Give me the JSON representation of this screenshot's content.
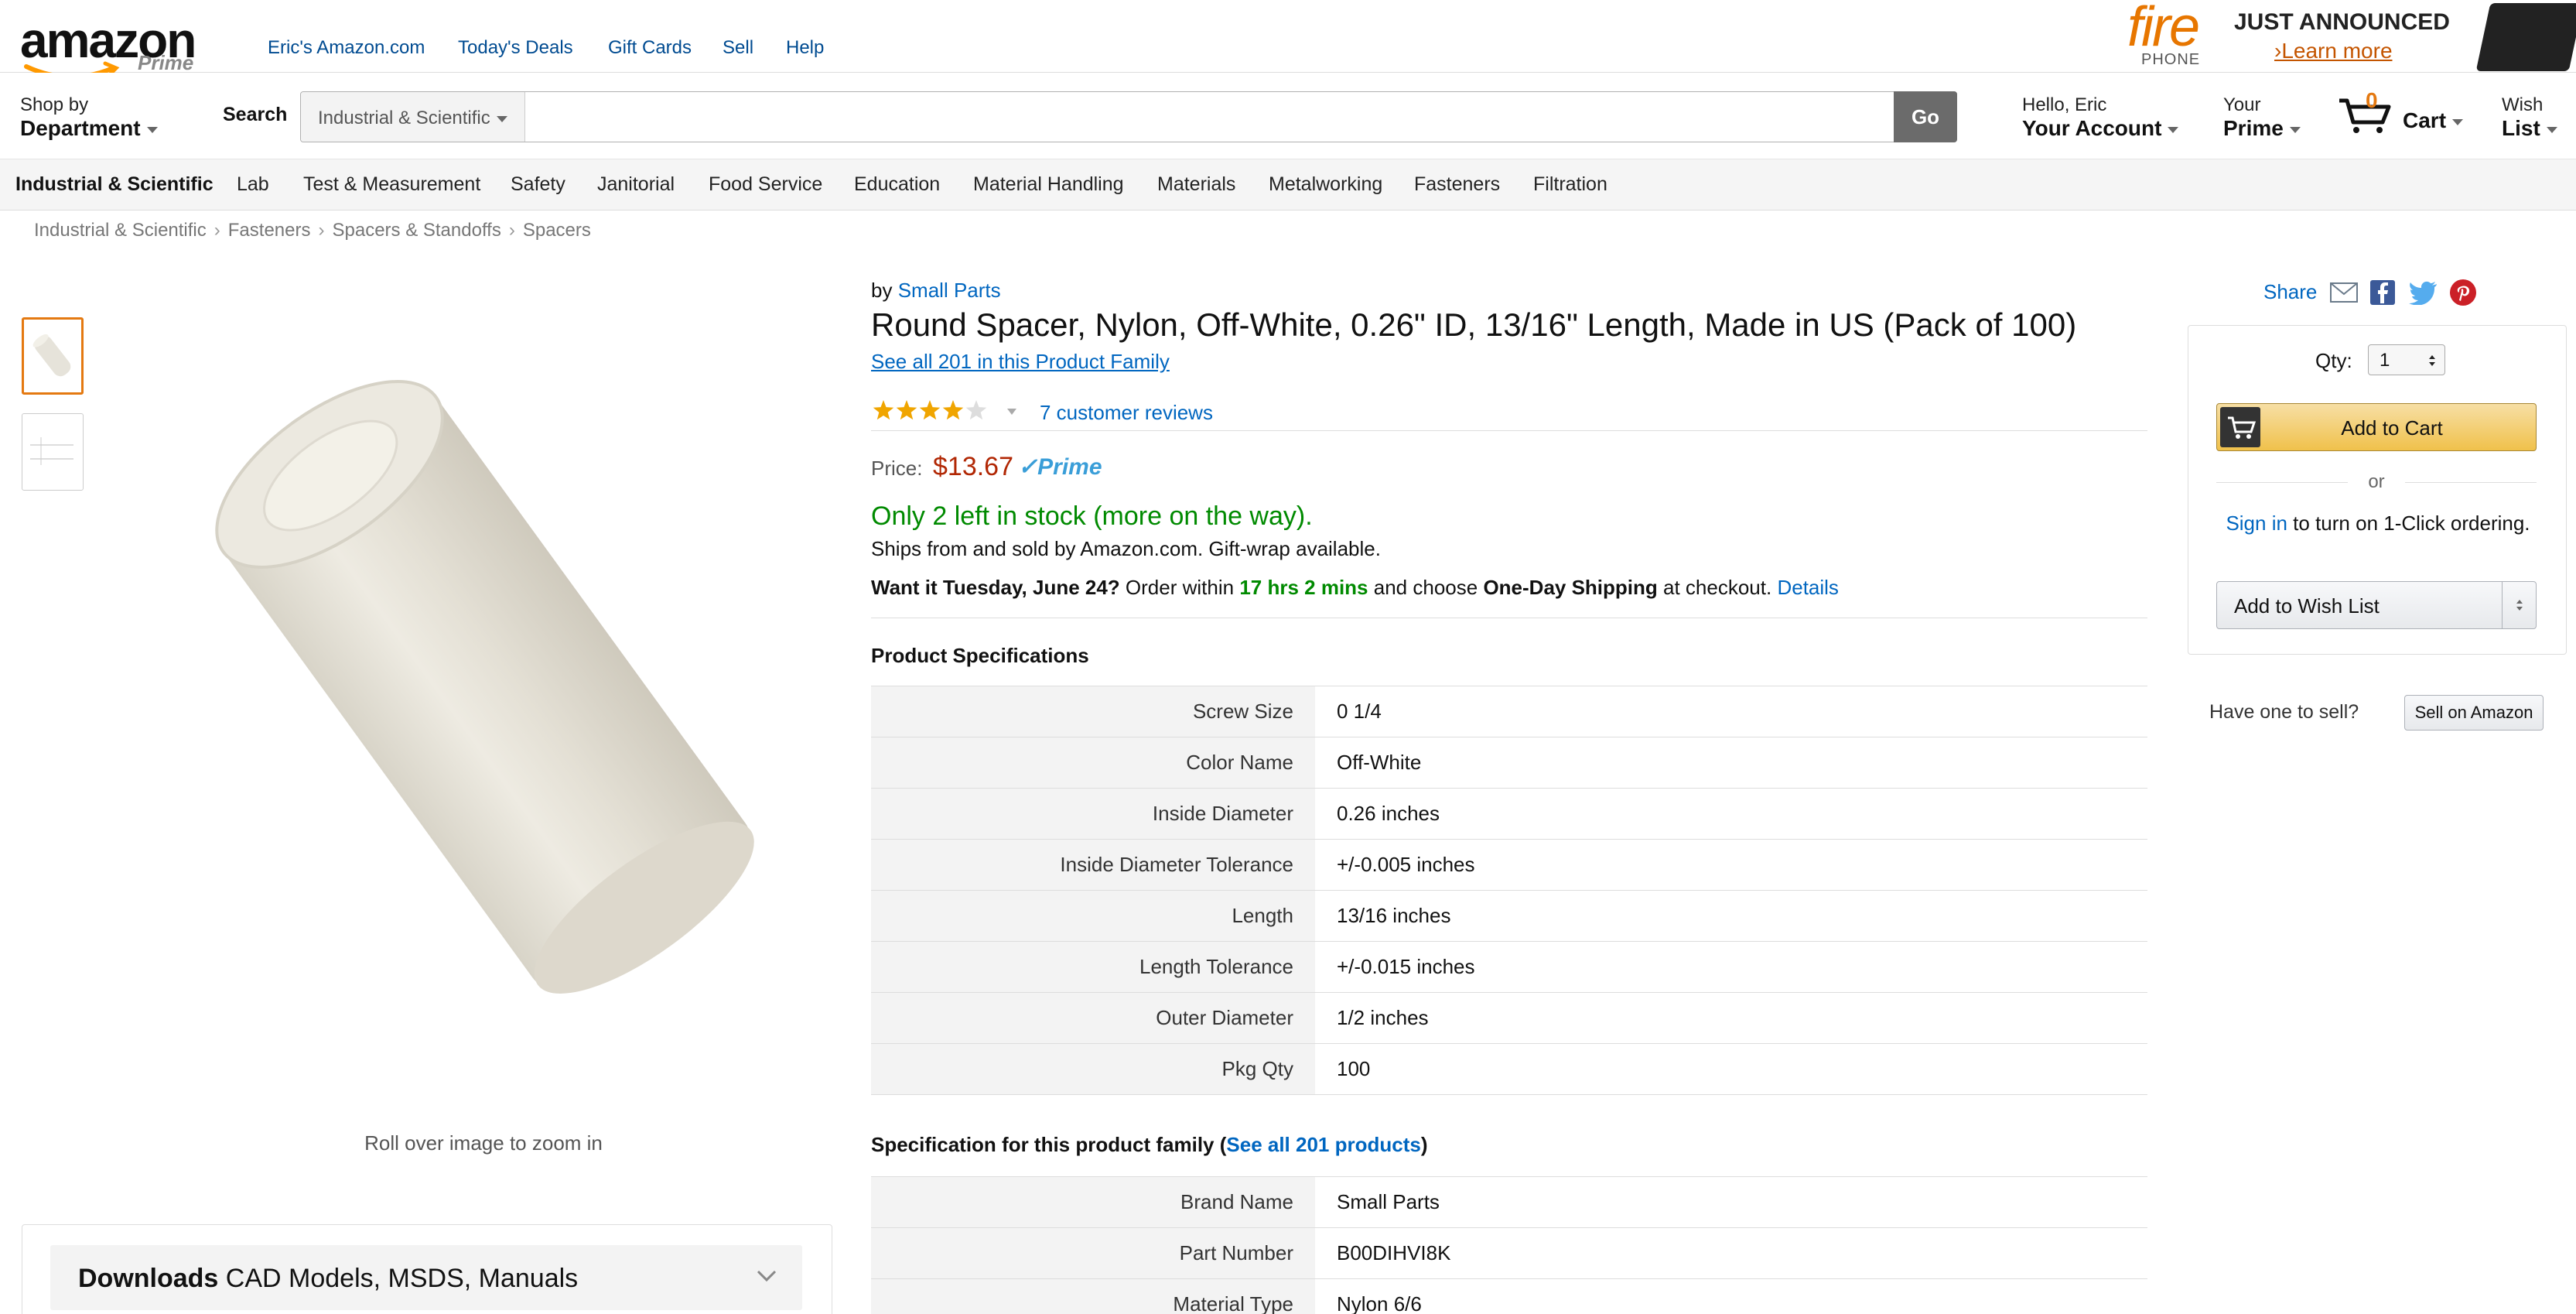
{
  "header": {
    "logo_text": "amazon",
    "logo_sub": "Prime",
    "links": [
      "Eric's Amazon.com",
      "Today's Deals",
      "Gift Cards",
      "Sell",
      "Help"
    ],
    "ad": {
      "brand": "fire",
      "sub": "PHONE",
      "headline": "JUST ANNOUNCED",
      "cta": "›Learn more"
    }
  },
  "nav": {
    "shop_by": "Shop by",
    "department": "Department",
    "search_label": "Search",
    "search_category": "Industrial & Scientific",
    "search_placeholder": "",
    "go": "Go",
    "account_small": "Hello, Eric",
    "account_big": "Your Account",
    "prime_small": "Your",
    "prime_big": "Prime",
    "cart_count": "0",
    "cart_label": "Cart",
    "wish_small": "Wish",
    "wish_big": "List"
  },
  "categories": [
    "Industrial & Scientific",
    "Lab",
    "Test & Measurement",
    "Safety",
    "Janitorial",
    "Food Service",
    "Education",
    "Material Handling",
    "Materials",
    "Metalworking",
    "Fasteners",
    "Filtration"
  ],
  "breadcrumbs": [
    "Industrial & Scientific",
    "Fasteners",
    "Spacers & Standoffs",
    "Spacers"
  ],
  "product": {
    "by": "by",
    "brand": "Small Parts",
    "title": "Round Spacer, Nylon, Off-White, 0.26\" ID, 13/16\" Length, Made in US (Pack of 100)",
    "family_link": "See all 201 in this Product Family",
    "rating": 4,
    "reviews": "7 customer reviews",
    "price_label": "Price:",
    "price": "$13.67",
    "prime": "✓Prime",
    "stock": "Only 2 left in stock (more on the way).",
    "ships": "Ships from and sold by Amazon.com. Gift-wrap available.",
    "want_a": "Want it Tuesday, June 24?",
    "want_b": "Order within",
    "want_time": "17 hrs 2 mins",
    "want_c": "and choose",
    "want_d": "One-Day Shipping",
    "want_e": "at checkout.",
    "details": "Details",
    "zoom_hint": "Roll over image to zoom in"
  },
  "specs_heading": "Product Specifications",
  "specs": [
    {
      "k": "Screw Size",
      "v": "0 1/4"
    },
    {
      "k": "Color Name",
      "v": "Off-White"
    },
    {
      "k": "Inside Diameter",
      "v": "0.26  inches"
    },
    {
      "k": "Inside Diameter Tolerance",
      "v": "+/-0.005  inches"
    },
    {
      "k": "Length",
      "v": "13/16  inches"
    },
    {
      "k": "Length Tolerance",
      "v": "+/-0.015  inches"
    },
    {
      "k": "Outer Diameter",
      "v": "1/2  inches"
    },
    {
      "k": "Pkg Qty",
      "v": "100"
    }
  ],
  "family_heading_a": "Specification for this product family (",
  "family_heading_link": "See all 201 products",
  "family_heading_b": ")",
  "family_specs": [
    {
      "k": "Brand Name",
      "v": "Small Parts"
    },
    {
      "k": "Part Number",
      "v": "B00DIHVI8K"
    },
    {
      "k": "Material Type",
      "v": "Nylon 6/6"
    }
  ],
  "downloads": {
    "bold": "Downloads",
    "rest": "CAD Models, MSDS, Manuals"
  },
  "buybox": {
    "share": "Share",
    "qty_label": "Qty:",
    "qty_value": "1",
    "add_to_cart": "Add to Cart",
    "or": "or",
    "sign_in": "Sign in",
    "one_click": "to turn on 1-Click ordering.",
    "wish_list": "Add to Wish List",
    "have_one": "Have one to sell?",
    "sell_btn": "Sell on Amazon"
  },
  "colors": {
    "link": "#0066c0",
    "price": "#b12704",
    "stock": "#008a00",
    "accent": "#e47911"
  }
}
